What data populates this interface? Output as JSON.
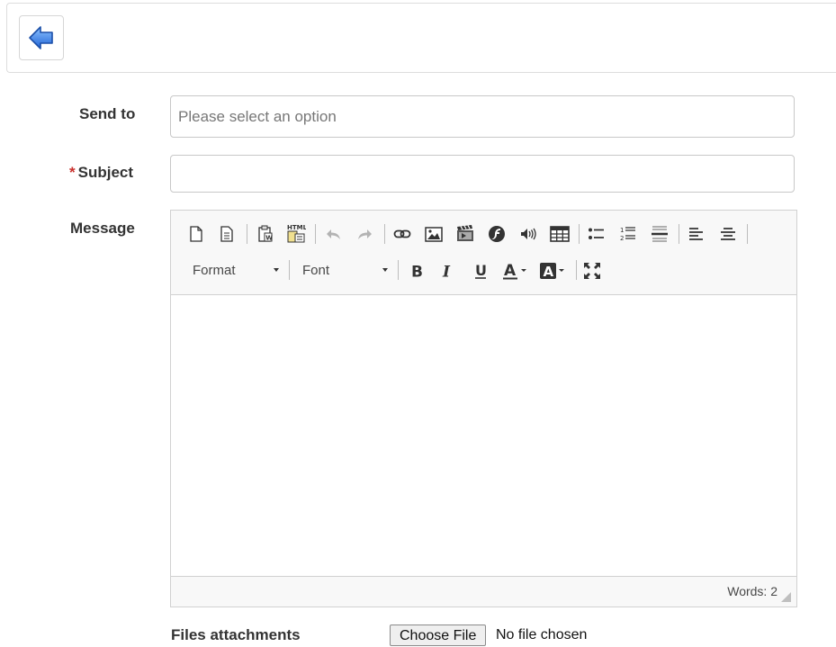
{
  "header": {
    "back_icon": "back-arrow-icon"
  },
  "form": {
    "send_to": {
      "label": "Send to",
      "placeholder": "Please select an option"
    },
    "subject": {
      "required_mark": "*",
      "label": "Subject",
      "value": ""
    },
    "message": {
      "label": "Message"
    }
  },
  "editor": {
    "toolbar_row1": [
      "new-page-icon",
      "preview-icon",
      "paste-from-word-icon",
      "paste-html-icon",
      "undo-icon",
      "redo-icon",
      "link-icon",
      "image-icon",
      "video-icon",
      "flash-icon",
      "audio-icon",
      "table-icon",
      "bulleted-list-icon",
      "numbered-list-icon",
      "horizontal-rule-icon",
      "align-left-icon",
      "align-center-icon"
    ],
    "format_label": "Format",
    "font_label": "Font",
    "toolbar_row2": [
      "bold-icon",
      "italic-icon",
      "underline-icon",
      "text-color-icon",
      "background-color-icon",
      "maximize-icon"
    ],
    "word_count": "Words: 2"
  },
  "attachments": {
    "label": "Files attachments",
    "button_label": "Choose File",
    "status": "No file chosen"
  },
  "colors": {
    "accent": "#2f7ad9",
    "required": "#c9302c",
    "border": "#c8c8c8"
  }
}
